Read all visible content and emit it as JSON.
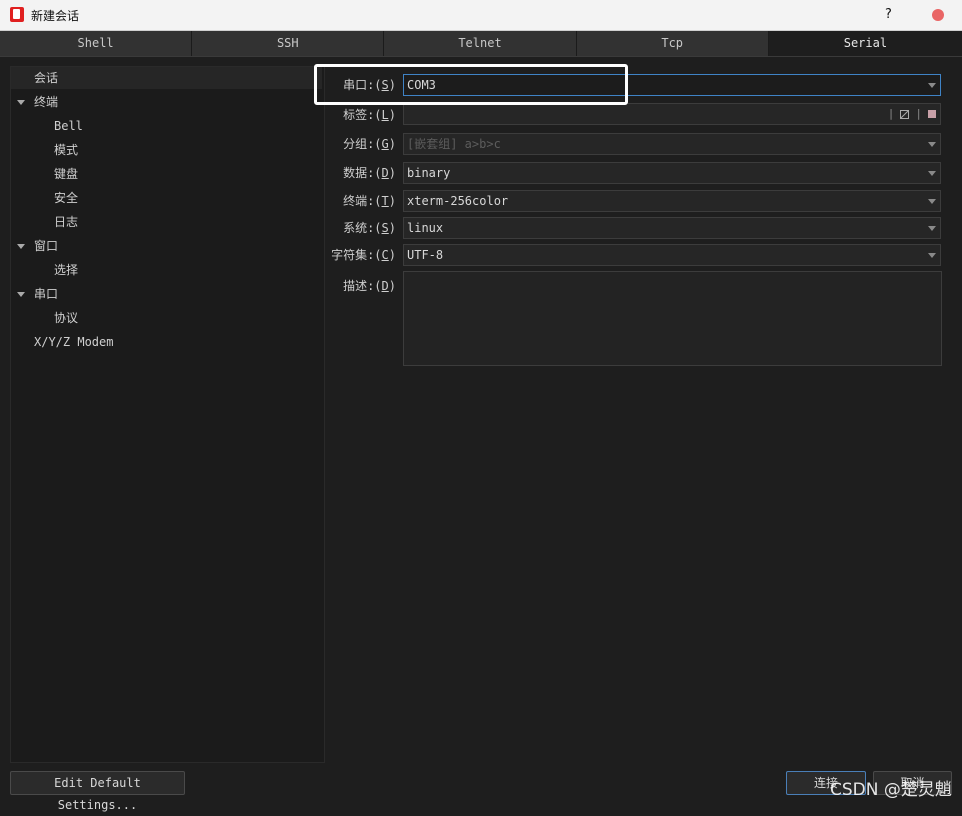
{
  "window": {
    "title": "新建会话",
    "help": "?",
    "close_color": "#e96565"
  },
  "tabs": [
    {
      "label": "Shell"
    },
    {
      "label": "SSH"
    },
    {
      "label": "Telnet"
    },
    {
      "label": "Tcp"
    },
    {
      "label": "Serial",
      "active": true
    }
  ],
  "tree": [
    {
      "label": "会话",
      "selected": true
    },
    {
      "label": "终端",
      "expanded": true
    },
    {
      "label": "Bell"
    },
    {
      "label": "模式"
    },
    {
      "label": "键盘"
    },
    {
      "label": "安全"
    },
    {
      "label": "日志"
    },
    {
      "label": "窗口",
      "expanded": true
    },
    {
      "label": "选择"
    },
    {
      "label": "串口",
      "expanded": true
    },
    {
      "label": "协议"
    },
    {
      "label": "X/Y/Z Modem"
    }
  ],
  "form": {
    "port": {
      "label_prefix": "串口:(",
      "key": "S",
      "label_suffix": ")",
      "value": "COM3"
    },
    "tag": {
      "label_prefix": "标签:(",
      "key": "L",
      "label_suffix": ")",
      "value": ""
    },
    "group": {
      "label_prefix": "分组:(",
      "key": "G",
      "label_suffix": ")",
      "placeholder": "[嵌套组] a>b>c"
    },
    "data": {
      "label_prefix": "数据:(",
      "key": "D",
      "label_suffix": ")",
      "value": "binary"
    },
    "terminal": {
      "label_prefix": "终端:(",
      "key": "T",
      "label_suffix": ")",
      "value": "xterm-256color"
    },
    "system": {
      "label_prefix": "系统:(",
      "key": "S",
      "label_suffix": ")",
      "value": "linux"
    },
    "charset": {
      "label_prefix": "字符集:(",
      "key": "C",
      "label_suffix": ")",
      "value": "UTF-8"
    },
    "desc": {
      "label_prefix": "描述:(",
      "key": "D",
      "label_suffix": ")",
      "value": ""
    }
  },
  "buttons": {
    "edit_default": "Edit Default Settings...",
    "connect": "连接",
    "cancel": "取消"
  },
  "watermark": "CSDN @楚灵魈",
  "colors": {
    "focus_border": "#3f83c6",
    "highlight_box": "#ffffff"
  }
}
